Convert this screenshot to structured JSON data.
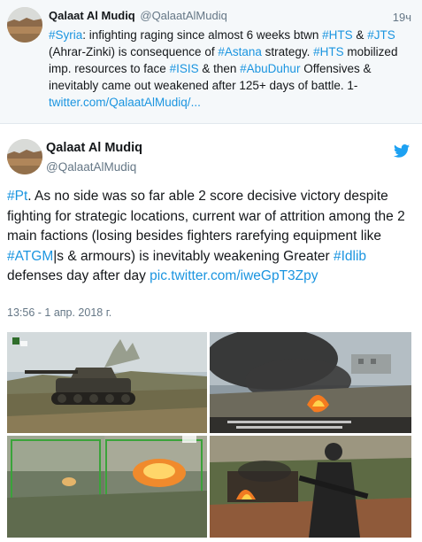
{
  "parent_tweet": {
    "author_name": "Qalaat Al Mudiq",
    "author_handle": "@QalaatAlMudiq",
    "time": "19ч",
    "text_parts": [
      {
        "text": "#Syria",
        "kind": "link"
      },
      {
        "text": ": infighting raging since almost 6 weeks btwn ",
        "kind": "plain"
      },
      {
        "text": "#HTS",
        "kind": "link"
      },
      {
        "text": " & ",
        "kind": "plain"
      },
      {
        "text": "#JTS",
        "kind": "link"
      },
      {
        "text": " (Ahrar-Zinki) is consequence of ",
        "kind": "plain"
      },
      {
        "text": "#Astana",
        "kind": "link"
      },
      {
        "text": " strategy. ",
        "kind": "plain"
      },
      {
        "text": "#HTS",
        "kind": "link"
      },
      {
        "text": " mobilized imp. resources to face ",
        "kind": "plain"
      },
      {
        "text": "#ISIS",
        "kind": "link"
      },
      {
        "text": " & then ",
        "kind": "plain"
      },
      {
        "text": "#AbuDuhur",
        "kind": "link"
      },
      {
        "text": " Offensives & inevitably came out weakened after 125+ days of battle. 1- ",
        "kind": "plain"
      },
      {
        "text": "twitter.com/QalaatAlMudiq/...",
        "kind": "link"
      }
    ]
  },
  "main_tweet": {
    "author_name": "Qalaat Al Mudiq",
    "author_handle": "@QalaatAlMudiq",
    "text_parts": [
      {
        "text": "#Pt",
        "kind": "link"
      },
      {
        "text": ". As no side was so far able 2 score decisive victory despite fighting for strategic locations, current war of attrition among the 2 main factions (losing besides fighters rarefying equipment like ",
        "kind": "plain"
      },
      {
        "text": "#ATGM",
        "kind": "link"
      },
      {
        "text": "|s & armours) is inevitably weakening Greater ",
        "kind": "plain"
      },
      {
        "text": "#Idlib",
        "kind": "link"
      },
      {
        "text": " defenses day after day ",
        "kind": "plain"
      },
      {
        "text": "pic.twitter.com/iweGpT3Zpy",
        "kind": "link"
      }
    ],
    "date": "13:56 - 1 апр. 2018 г.",
    "media": [
      {
        "icon": "tank-photo"
      },
      {
        "icon": "smoke-fire-photo"
      },
      {
        "icon": "explosion-split-photo"
      },
      {
        "icon": "fighter-burning-vehicle-photo"
      }
    ]
  },
  "colors": {
    "link": "#1b95e0",
    "text": "#14171a",
    "secondary": "#657786",
    "parent_bg": "#f5f8fa",
    "twitter_blue": "#1da1f2"
  }
}
